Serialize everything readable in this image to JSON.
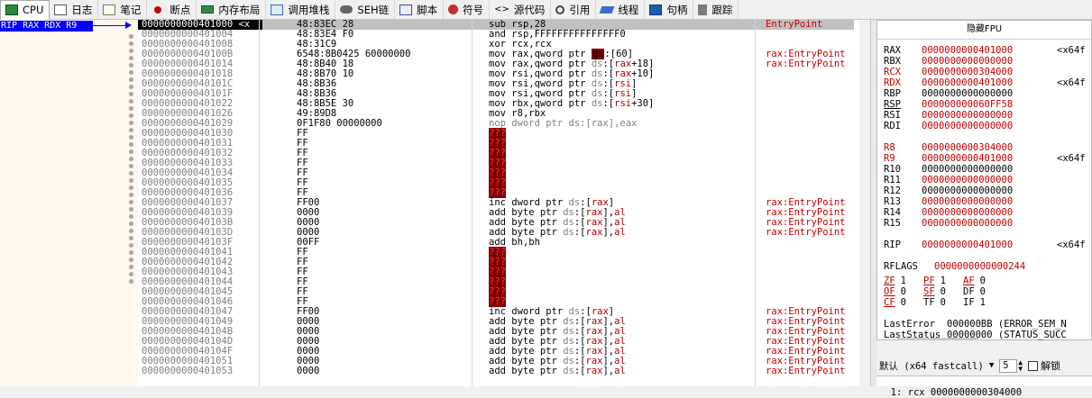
{
  "tabs": [
    {
      "label": "CPU",
      "icon": "cpu-icon",
      "active": true
    },
    {
      "label": "日志",
      "icon": "log-icon"
    },
    {
      "label": "笔记",
      "icon": "notes-icon"
    },
    {
      "label": "断点",
      "icon": "breakpoint-icon"
    },
    {
      "label": "内存布局",
      "icon": "memory-map-icon"
    },
    {
      "label": "调用堆栈",
      "icon": "call-stack-icon"
    },
    {
      "label": "SEH链",
      "icon": "seh-icon"
    },
    {
      "label": "脚本",
      "icon": "script-icon"
    },
    {
      "label": "符号",
      "icon": "symbols-icon"
    },
    {
      "label": "源代码",
      "icon": "source-icon"
    },
    {
      "label": "引用",
      "icon": "references-icon"
    },
    {
      "label": "线程",
      "icon": "threads-icon"
    },
    {
      "label": "句柄",
      "icon": "handles-icon"
    },
    {
      "label": "跟踪",
      "icon": "trace-icon"
    }
  ],
  "gutter": {
    "register_label": "RIP RAX RDX R9"
  },
  "disasm": [
    {
      "addr": "0000000000401000",
      "addr_suffix": " <x",
      "bytes": "48:83EC 28",
      "ins": [
        [
          "sub ",
          ""
        ],
        [
          "rsp",
          "reg"
        ],
        [
          ",28",
          ""
        ]
      ],
      "comment": "EntryPoint",
      "selected": true
    },
    {
      "addr": "0000000000401004",
      "bytes": "48:83E4 F0",
      "ins": [
        [
          "and ",
          ""
        ],
        [
          "rsp",
          "reg"
        ],
        [
          ",FFFFFFFFFFFFFFF0",
          ""
        ]
      ],
      "comment": ""
    },
    {
      "addr": "0000000000401008",
      "bytes": "48:31C9",
      "ins": [
        [
          "xor ",
          ""
        ],
        [
          "rcx",
          "reg"
        ],
        [
          ",",
          ""
        ],
        [
          "rcx",
          "reg"
        ]
      ],
      "comment": ""
    },
    {
      "addr": "000000000040100B",
      "bytes": "6548:8B0425 60000000",
      "ins": [
        [
          "mov ",
          ""
        ],
        [
          "rax",
          "reg"
        ],
        [
          ",qword ptr ",
          ""
        ],
        [
          "gs",
          "bad2"
        ],
        [
          ":[60]",
          ""
        ]
      ],
      "comment": "rax:EntryPoint"
    },
    {
      "addr": "0000000000401014",
      "bytes": "48:8B40 18",
      "ins": [
        [
          "mov ",
          ""
        ],
        [
          "rax",
          "reg"
        ],
        [
          ",qword ptr ",
          ""
        ],
        [
          "ds",
          "seg"
        ],
        [
          ":[",
          ""
        ],
        [
          "rax",
          "rr"
        ],
        [
          "+18]",
          ""
        ]
      ],
      "comment": "rax:EntryPoint"
    },
    {
      "addr": "0000000000401018",
      "bytes": "48:8B70 10",
      "ins": [
        [
          "mov ",
          ""
        ],
        [
          "rsi",
          "reg"
        ],
        [
          ",qword ptr ",
          ""
        ],
        [
          "ds",
          "seg"
        ],
        [
          ":[",
          ""
        ],
        [
          "rax",
          "rr"
        ],
        [
          "+10]",
          ""
        ]
      ],
      "comment": ""
    },
    {
      "addr": "000000000040101C",
      "bytes": "48:8B36",
      "ins": [
        [
          "mov ",
          ""
        ],
        [
          "rsi",
          "reg"
        ],
        [
          ",qword ptr ",
          ""
        ],
        [
          "ds",
          "seg"
        ],
        [
          ":[",
          ""
        ],
        [
          "rsi",
          "rr"
        ],
        [
          "]",
          ""
        ]
      ],
      "comment": ""
    },
    {
      "addr": "000000000040101F",
      "bytes": "48:8B36",
      "ins": [
        [
          "mov ",
          ""
        ],
        [
          "rsi",
          "reg"
        ],
        [
          ",qword ptr ",
          ""
        ],
        [
          "ds",
          "seg"
        ],
        [
          ":[",
          ""
        ],
        [
          "rsi",
          "rr"
        ],
        [
          "]",
          ""
        ]
      ],
      "comment": ""
    },
    {
      "addr": "0000000000401022",
      "bytes": "48:8B5E 30",
      "ins": [
        [
          "mov ",
          ""
        ],
        [
          "rbx",
          "reg"
        ],
        [
          ",qword ptr ",
          ""
        ],
        [
          "ds",
          "seg"
        ],
        [
          ":[",
          ""
        ],
        [
          "rsi",
          "rr"
        ],
        [
          "+30]",
          ""
        ]
      ],
      "comment": ""
    },
    {
      "addr": "0000000000401026",
      "bytes": "49:89D8",
      "ins": [
        [
          "mov ",
          ""
        ],
        [
          "r8",
          "reg"
        ],
        [
          ",",
          ""
        ],
        [
          "rbx",
          "reg"
        ]
      ],
      "comment": ""
    },
    {
      "addr": "0000000000401029",
      "bytes": "0F1F80 00000000",
      "ins": [
        [
          "nop dword ptr ds:[rax],eax",
          "dim"
        ]
      ],
      "comment": ""
    },
    {
      "addr": "0000000000401030",
      "bytes": "FF",
      "ins": [
        [
          "???",
          "bad"
        ]
      ],
      "comment": ""
    },
    {
      "addr": "0000000000401031",
      "bytes": "FF",
      "ins": [
        [
          "???",
          "bad"
        ]
      ],
      "comment": ""
    },
    {
      "addr": "0000000000401032",
      "bytes": "FF",
      "ins": [
        [
          "???",
          "bad"
        ]
      ],
      "comment": ""
    },
    {
      "addr": "0000000000401033",
      "bytes": "FF",
      "ins": [
        [
          "???",
          "bad"
        ]
      ],
      "comment": ""
    },
    {
      "addr": "0000000000401034",
      "bytes": "FF",
      "ins": [
        [
          "???",
          "bad"
        ]
      ],
      "comment": ""
    },
    {
      "addr": "0000000000401035",
      "bytes": "FF",
      "ins": [
        [
          "???",
          "bad"
        ]
      ],
      "comment": ""
    },
    {
      "addr": "0000000000401036",
      "bytes": "FF",
      "ins": [
        [
          "???",
          "bad"
        ]
      ],
      "comment": ""
    },
    {
      "addr": "0000000000401037",
      "bytes": "FF00",
      "ins": [
        [
          "inc dword ptr ",
          ""
        ],
        [
          "ds",
          "seg"
        ],
        [
          ":[",
          ""
        ],
        [
          "rax",
          "rr"
        ],
        [
          "]",
          ""
        ]
      ],
      "comment": "rax:EntryPoint"
    },
    {
      "addr": "0000000000401039",
      "bytes": "0000",
      "ins": [
        [
          "add byte ptr ",
          ""
        ],
        [
          "ds",
          "seg"
        ],
        [
          ":[",
          ""
        ],
        [
          "rax",
          "rr"
        ],
        [
          "],",
          ""
        ],
        [
          "al",
          "rr"
        ]
      ],
      "comment": "rax:EntryPoint"
    },
    {
      "addr": "000000000040103B",
      "bytes": "0000",
      "ins": [
        [
          "add byte ptr ",
          ""
        ],
        [
          "ds",
          "seg"
        ],
        [
          ":[",
          ""
        ],
        [
          "rax",
          "rr"
        ],
        [
          "],",
          ""
        ],
        [
          "al",
          "rr"
        ]
      ],
      "comment": "rax:EntryPoint"
    },
    {
      "addr": "000000000040103D",
      "bytes": "0000",
      "ins": [
        [
          "add byte ptr ",
          ""
        ],
        [
          "ds",
          "seg"
        ],
        [
          ":[",
          ""
        ],
        [
          "rax",
          "rr"
        ],
        [
          "],",
          ""
        ],
        [
          "al",
          "rr"
        ]
      ],
      "comment": "rax:EntryPoint"
    },
    {
      "addr": "000000000040103F",
      "bytes": "00FF",
      "ins": [
        [
          "add ",
          ""
        ],
        [
          "bh",
          "reg"
        ],
        [
          ",",
          ""
        ],
        [
          "bh",
          "reg"
        ]
      ],
      "comment": ""
    },
    {
      "addr": "0000000000401041",
      "bytes": "FF",
      "ins": [
        [
          "???",
          "bad"
        ]
      ],
      "comment": ""
    },
    {
      "addr": "0000000000401042",
      "bytes": "FF",
      "ins": [
        [
          "???",
          "bad"
        ]
      ],
      "comment": ""
    },
    {
      "addr": "0000000000401043",
      "bytes": "FF",
      "ins": [
        [
          "???",
          "bad"
        ]
      ],
      "comment": ""
    },
    {
      "addr": "0000000000401044",
      "bytes": "FF",
      "ins": [
        [
          "???",
          "bad"
        ]
      ],
      "comment": ""
    },
    {
      "addr": "0000000000401045",
      "bytes": "FF",
      "ins": [
        [
          "???",
          "bad"
        ]
      ],
      "comment": ""
    },
    {
      "addr": "0000000000401046",
      "bytes": "FF",
      "ins": [
        [
          "???",
          "bad"
        ]
      ],
      "comment": ""
    },
    {
      "addr": "0000000000401047",
      "bytes": "FF00",
      "ins": [
        [
          "inc dword ptr ",
          ""
        ],
        [
          "ds",
          "seg"
        ],
        [
          ":[",
          ""
        ],
        [
          "rax",
          "rr"
        ],
        [
          "]",
          ""
        ]
      ],
      "comment": "rax:EntryPoint"
    },
    {
      "addr": "0000000000401049",
      "bytes": "0000",
      "ins": [
        [
          "add byte ptr ",
          ""
        ],
        [
          "ds",
          "seg"
        ],
        [
          ":[",
          ""
        ],
        [
          "rax",
          "rr"
        ],
        [
          "],",
          ""
        ],
        [
          "al",
          "rr"
        ]
      ],
      "comment": "rax:EntryPoint"
    },
    {
      "addr": "000000000040104B",
      "bytes": "0000",
      "ins": [
        [
          "add byte ptr ",
          ""
        ],
        [
          "ds",
          "seg"
        ],
        [
          ":[",
          ""
        ],
        [
          "rax",
          "rr"
        ],
        [
          "],",
          ""
        ],
        [
          "al",
          "rr"
        ]
      ],
      "comment": "rax:EntryPoint"
    },
    {
      "addr": "000000000040104D",
      "bytes": "0000",
      "ins": [
        [
          "add byte ptr ",
          ""
        ],
        [
          "ds",
          "seg"
        ],
        [
          ":[",
          ""
        ],
        [
          "rax",
          "rr"
        ],
        [
          "],",
          ""
        ],
        [
          "al",
          "rr"
        ]
      ],
      "comment": "rax:EntryPoint"
    },
    {
      "addr": "000000000040104F",
      "bytes": "0000",
      "ins": [
        [
          "add byte ptr ",
          ""
        ],
        [
          "ds",
          "seg"
        ],
        [
          ":[",
          ""
        ],
        [
          "rax",
          "rr"
        ],
        [
          "],",
          ""
        ],
        [
          "al",
          "rr"
        ]
      ],
      "comment": "rax:EntryPoint"
    },
    {
      "addr": "0000000000401051",
      "bytes": "0000",
      "ins": [
        [
          "add byte ptr ",
          ""
        ],
        [
          "ds",
          "seg"
        ],
        [
          ":[",
          ""
        ],
        [
          "rax",
          "rr"
        ],
        [
          "],",
          ""
        ],
        [
          "al",
          "rr"
        ]
      ],
      "comment": "rax:EntryPoint"
    },
    {
      "addr": "0000000000401053",
      "bytes": "0000",
      "ins": [
        [
          "add byte ptr ",
          ""
        ],
        [
          "ds",
          "seg"
        ],
        [
          ":[",
          ""
        ],
        [
          "rax",
          "rr"
        ],
        [
          "],",
          ""
        ],
        [
          "al",
          "rr"
        ]
      ],
      "comment": "rax:EntryPoint"
    }
  ],
  "fpu_panel": {
    "title": "隐藏FPU",
    "registers": [
      {
        "name": "RAX",
        "value": "0000000000401000",
        "extra": "<x64f"
      },
      {
        "name": "RBX",
        "value": "0000000000000000"
      },
      {
        "name": "RCX",
        "value": "0000000000304000",
        "name_red": true
      },
      {
        "name": "RDX",
        "value": "0000000000401000",
        "extra": "<x64f",
        "name_red": true
      },
      {
        "name": "RBP",
        "value": "0000000000000000",
        "black": true
      },
      {
        "name": "RSP",
        "value": "000000000060FF58",
        "underline": true
      },
      {
        "name": "RSI",
        "value": "0000000000000000"
      },
      {
        "name": "RDI",
        "value": "0000000000000000"
      },
      {
        "gap": true
      },
      {
        "name": "R8",
        "value": "0000000000304000",
        "name_red": true
      },
      {
        "name": "R9",
        "value": "0000000000401000",
        "extra": "<x64f",
        "name_red": true
      },
      {
        "name": "R10",
        "value": "0000000000000000",
        "black": true
      },
      {
        "name": "R11",
        "value": "0000000000000000"
      },
      {
        "name": "R12",
        "value": "0000000000000000",
        "black": true
      },
      {
        "name": "R13",
        "value": "0000000000000000"
      },
      {
        "name": "R14",
        "value": "0000000000000000"
      },
      {
        "name": "R15",
        "value": "0000000000000000"
      },
      {
        "gap": true
      },
      {
        "name": "RIP",
        "value": "0000000000401000",
        "extra": "<x64f"
      },
      {
        "gap": true
      },
      {
        "name": "RFLAGS",
        "value": "0000000000000244",
        "wide": true
      }
    ],
    "flags": [
      [
        {
          "n": "ZF",
          "v": "1",
          "ul": true
        },
        {
          "n": "PF",
          "v": "1",
          "ul": true
        },
        {
          "n": "AF",
          "v": "0",
          "ul": true
        }
      ],
      [
        {
          "n": "OF",
          "v": "0",
          "ul": true
        },
        {
          "n": "SF",
          "v": "0",
          "ul": true
        },
        {
          "n": "DF",
          "v": "0"
        }
      ],
      [
        {
          "n": "CF",
          "v": "0",
          "ul": true
        },
        {
          "n": "TF",
          "v": "0"
        },
        {
          "n": "IF",
          "v": "1"
        }
      ]
    ],
    "last_error_label": "LastError",
    "last_error_value": "000000BB (ERROR_SEM_N",
    "last_status_label": "LastStatus",
    "last_status_value": "00000000 (STATUS_SUCC"
  },
  "callconv": {
    "selected": "默认 (x64 fastcall)",
    "arg_count": "5",
    "lock_label": "解锁"
  },
  "stack_line": "1: rcx 0000000000304000"
}
